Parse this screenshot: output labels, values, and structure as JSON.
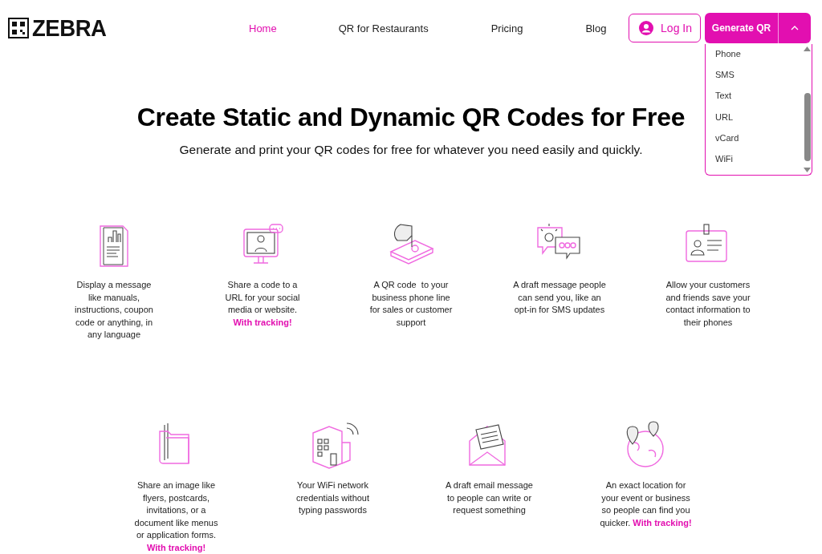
{
  "header": {
    "logo": "ZEBRA",
    "nav": [
      {
        "label": "Home",
        "selected": true
      },
      {
        "label": "QR for Restaurants",
        "selected": false
      },
      {
        "label": "Pricing",
        "selected": false
      },
      {
        "label": "Blog",
        "selected": false
      }
    ],
    "login": "Log In",
    "generate": {
      "label": "Generate QR",
      "expanded": true
    },
    "menu": [
      "Phone",
      "SMS",
      "Text",
      "URL",
      "vCard",
      "WiFi"
    ]
  },
  "hero": {
    "title": "Create Static and Dynamic QR Codes for Free",
    "subtitle": "Generate and print your QR codes for free for whatever you need easily and quickly."
  },
  "features": [
    [
      {
        "text": "Display a message like manuals, instructions, coupon code or anything, in any language"
      },
      {
        "text": "Share a code to a URL for your social media or website.",
        "highlight": "With tracking!"
      },
      {
        "text": "A QR code  to your business phone line for sales or customer support"
      },
      {
        "text": "A draft message people can send you, like an opt-in for SMS updates"
      },
      {
        "text": "Allow your customers and friends save your contact information to their phones"
      }
    ],
    [
      {
        "text": "Share an image like flyers, postcards, invitations, or a document like menus or application forms.",
        "highlight": "With tracking!"
      },
      {
        "text": "Your WiFi network credentials without typing passwords"
      },
      {
        "text": "A draft email message to people can write or request something"
      },
      {
        "text": "An exact location for your event or business so people can find you quicker.",
        "highlight": "With tracking!"
      }
    ]
  ]
}
